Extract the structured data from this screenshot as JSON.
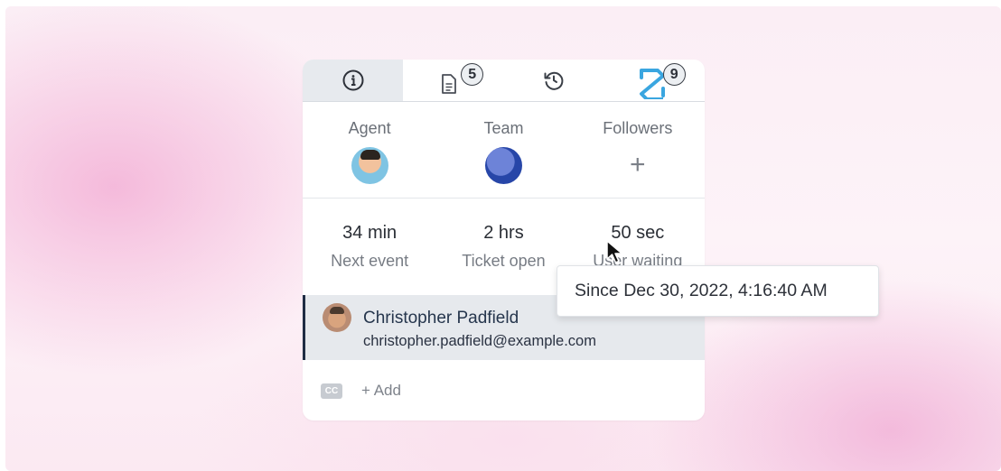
{
  "tabs": [
    {
      "name": "info",
      "icon": "info-icon",
      "active": true
    },
    {
      "name": "documents",
      "icon": "document-icon",
      "badge": "5"
    },
    {
      "name": "history",
      "icon": "history-icon"
    },
    {
      "name": "integration",
      "icon": "integration-logo-icon",
      "badge": "9"
    }
  ],
  "people": {
    "agent_label": "Agent",
    "team_label": "Team",
    "followers_label": "Followers",
    "add_follower": "+"
  },
  "stats": [
    {
      "value": "34 min",
      "label": "Next event"
    },
    {
      "value": "2 hrs",
      "label": "Ticket open"
    },
    {
      "value": "50 sec",
      "label": "User waiting"
    }
  ],
  "requester": {
    "name": "Christopher Padfield",
    "email": "christopher.padfield@example.com"
  },
  "cc": {
    "icon_text": "CC",
    "add_label": "+ Add"
  },
  "tooltip": {
    "text": "Since Dec 30, 2022, 4:16:40 AM"
  },
  "colors": {
    "accent": "#1f2d44",
    "integration_logo": "#3aa6e0"
  }
}
